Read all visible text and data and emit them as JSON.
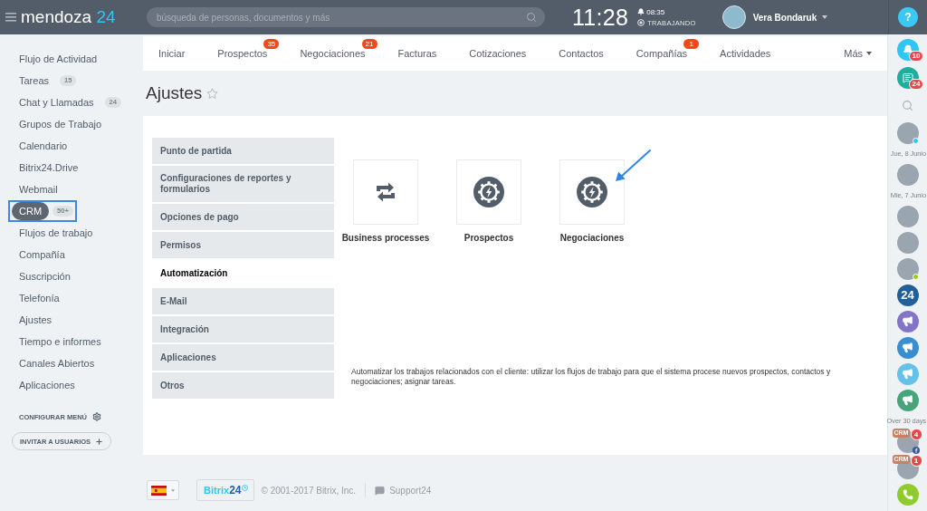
{
  "header": {
    "logo": {
      "name": "mendoza",
      "number": "24"
    },
    "search": {
      "placeholder": "búsqueda de personas, documentos y más"
    },
    "clock": "11:28",
    "alarm": "08:35",
    "work_status": "TRABAJANDO",
    "user": {
      "name": "Vera Bondaruk"
    },
    "help": "?"
  },
  "sidebar": {
    "items": [
      {
        "label": "Flujo de Actividad",
        "selected": false,
        "highlighted": false
      },
      {
        "label": "Tareas",
        "count": "15",
        "selected": false,
        "highlighted": false
      },
      {
        "label": "Chat y Llamadas",
        "count": "24",
        "selected": false,
        "highlighted": false
      },
      {
        "label": "Grupos de Trabajo",
        "selected": false,
        "highlighted": false
      },
      {
        "label": "Calendario",
        "selected": false,
        "highlighted": false
      },
      {
        "label": "Bitrix24.Drive",
        "selected": false,
        "highlighted": false
      },
      {
        "label": "Webmail",
        "selected": false,
        "highlighted": false
      },
      {
        "label": "CRM",
        "count": "50+",
        "selected": true,
        "highlighted": true
      },
      {
        "label": "Flujos de trabajo",
        "selected": false,
        "highlighted": false
      },
      {
        "label": "Compañía",
        "selected": false,
        "highlighted": false
      },
      {
        "label": "Suscripción",
        "selected": false,
        "highlighted": false
      },
      {
        "label": "Telefonía",
        "selected": false,
        "highlighted": false
      },
      {
        "label": "Ajustes",
        "selected": false,
        "highlighted": false
      },
      {
        "label": "Tiempo e informes",
        "selected": false,
        "highlighted": false
      },
      {
        "label": "Canales Abiertos",
        "selected": false,
        "highlighted": false
      },
      {
        "label": "Aplicaciones",
        "selected": false,
        "highlighted": false
      }
    ],
    "configure": "CONFIGURAR MENÚ",
    "invite": "INVITAR A USUARIOS"
  },
  "tabs": [
    {
      "label": "Iniciar",
      "kind": "link"
    },
    {
      "label": "Prospectos",
      "kind": "link",
      "badge": "35"
    },
    {
      "label": "Negociaciones",
      "kind": "link",
      "badge": "21"
    },
    {
      "label": "Facturas",
      "kind": "link"
    },
    {
      "label": "Cotizaciones",
      "kind": "link"
    },
    {
      "label": "Contactos",
      "kind": "link"
    },
    {
      "label": "Compañías",
      "kind": "link",
      "badge": "1"
    },
    {
      "label": "Actividades",
      "kind": "link"
    },
    {
      "label": "Más",
      "kind": "more"
    }
  ],
  "page": {
    "title": "Ajustes",
    "starred": false
  },
  "settings_menu": [
    {
      "label": "Punto de partida",
      "selected": false
    },
    {
      "label": "Configuraciones de reportes y formularios",
      "selected": false
    },
    {
      "label": "Opciones de pago",
      "selected": false
    },
    {
      "label": "Permisos",
      "selected": false
    },
    {
      "label": "Automatización",
      "selected": true
    },
    {
      "label": "E-Mail",
      "selected": false
    },
    {
      "label": "Integración",
      "selected": false
    },
    {
      "label": "Aplicaciones",
      "selected": false
    },
    {
      "label": "Otros",
      "selected": false
    }
  ],
  "tiles": [
    {
      "label": "Business processes",
      "kind": "process",
      "highlighted": false
    },
    {
      "label": "Prospectos",
      "kind": "automation",
      "highlighted": false
    },
    {
      "label": "Negociaciones",
      "kind": "automation",
      "highlighted": true
    }
  ],
  "description": "Automatizar los trabajos relacionados con el cliente: utilizar los flujos de trabajo para que el sistema procese nuevos prospectos, contactos y negociaciones; asignar tareas.",
  "footer": {
    "logo": {
      "name": "Bitrix",
      "number": "24"
    },
    "copyright": "© 2001-2017 Bitrix, Inc.",
    "support": "Support24"
  },
  "right_bar": [
    {
      "kind": "notifications",
      "badge": "10"
    },
    {
      "kind": "chats",
      "badge": "24"
    },
    {
      "kind": "search"
    },
    {
      "kind": "contact",
      "color": "#2fc6f6"
    },
    {
      "kind": "date",
      "label": "Jue, 8 Junio"
    },
    {
      "kind": "contact"
    },
    {
      "kind": "date",
      "label": "Mie, 7 Junio"
    },
    {
      "kind": "contact"
    },
    {
      "kind": "contact"
    },
    {
      "kind": "contact",
      "color": "#9dcf00"
    },
    {
      "kind": "logo",
      "label": "24"
    },
    {
      "kind": "channel",
      "color": "#8474c8"
    },
    {
      "kind": "channel",
      "color": "#3a8ed0"
    },
    {
      "kind": "channel",
      "color": "#64c2e8"
    },
    {
      "kind": "channel",
      "color": "#47a47a"
    },
    {
      "kind": "date",
      "label": "Over 30 days"
    },
    {
      "kind": "crm",
      "tag": "CRM",
      "badge": "4",
      "social": true
    },
    {
      "kind": "crm",
      "tag": "CRM",
      "badge": "1",
      "social": false
    },
    {
      "kind": "call"
    }
  ]
}
